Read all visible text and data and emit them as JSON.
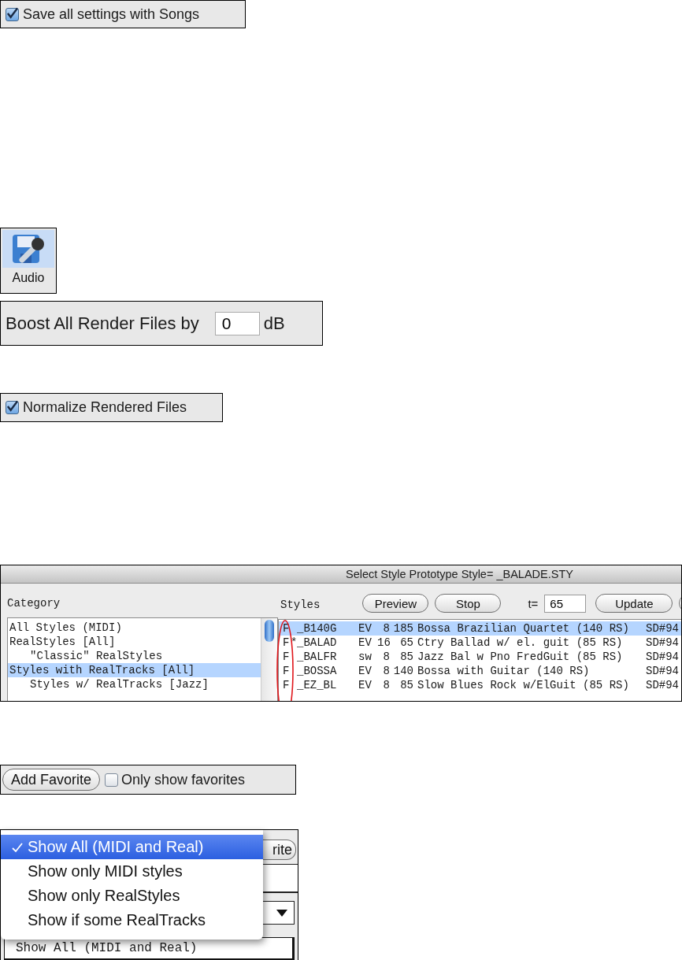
{
  "save_songs_checkbox": {
    "label": "Save all settings with Songs",
    "checked": true
  },
  "audio_button": {
    "label": "Audio",
    "selected": true
  },
  "boost": {
    "label": "Boost All Render Files by",
    "value": "0",
    "unit": "dB"
  },
  "normalize_checkbox": {
    "label": "Normalize Rendered Files",
    "checked": true
  },
  "style_dialog": {
    "title": "Select Style Prototype Style= _BALADE.STY",
    "category_label": "Category",
    "categories": [
      {
        "label": "All Styles (MIDI)",
        "selected": false
      },
      {
        "label": "RealStyles [All]",
        "selected": false,
        "children": [
          {
            "label": "\"Classic\" RealStyles",
            "selected": false
          }
        ]
      },
      {
        "label": "Styles with RealTracks [All]",
        "selected": true,
        "children": [
          {
            "label": "Styles w/ RealTracks [Jazz]",
            "selected": false
          }
        ]
      }
    ],
    "styles_label": "Styles",
    "buttons": [
      {
        "label": "Preview"
      },
      {
        "label": "Stop"
      }
    ],
    "tempo_label": "t=",
    "tempo_value": "65",
    "update_button": "Update",
    "partial_button_shown": true,
    "styles": [
      {
        "flag": "F",
        "name": "_B140G",
        "type": "EV",
        "column_5": "8",
        "tempo": "185",
        "description": "Bossa Brazilian Quartet (140 RS)",
        "code": "SD#94",
        "selected": true
      },
      {
        "flag": "F",
        "star": "*",
        "name": "_BALAD",
        "type": "EV",
        "column_5": "16",
        "tempo": "65",
        "description": "Ctry Ballad w/ el. guit (85 RS)",
        "code": "SD#94",
        "selected": false
      },
      {
        "flag": "F",
        "name": "_BALFR",
        "type": "sw",
        "column_5": "8",
        "tempo": "85",
        "description": "Jazz Bal w Pno FredGuit (85 RS)",
        "code": "SD#94",
        "selected": false
      },
      {
        "flag": "F",
        "name": "_BOSSA",
        "type": "EV",
        "column_5": "8",
        "tempo": "140",
        "description": "Bossa with Guitar (140 RS)",
        "code": "SD#94",
        "selected": false
      },
      {
        "flag": "F",
        "name": "_EZ_BL",
        "type": "EV",
        "column_5": "8",
        "tempo": "85",
        "description": "Slow Blues Rock w/ElGuit (85 RS)",
        "code": "SD#94",
        "selected": false
      }
    ]
  },
  "favorites": {
    "button": "Add Favorite",
    "checkbox": {
      "label": "Only show favorites",
      "checked": false
    }
  },
  "filter_menu": {
    "button_fragment": "rite",
    "field_value": "Show All (MIDI and Real)",
    "items": [
      {
        "label": "Show All (MIDI and Real)",
        "selected": true,
        "checked": true
      },
      {
        "label": "Show only MIDI styles",
        "selected": false,
        "checked": false
      },
      {
        "label": "Show only RealStyles",
        "selected": false,
        "checked": false
      },
      {
        "label": "Show if some RealTracks",
        "selected": false,
        "checked": false
      }
    ]
  }
}
